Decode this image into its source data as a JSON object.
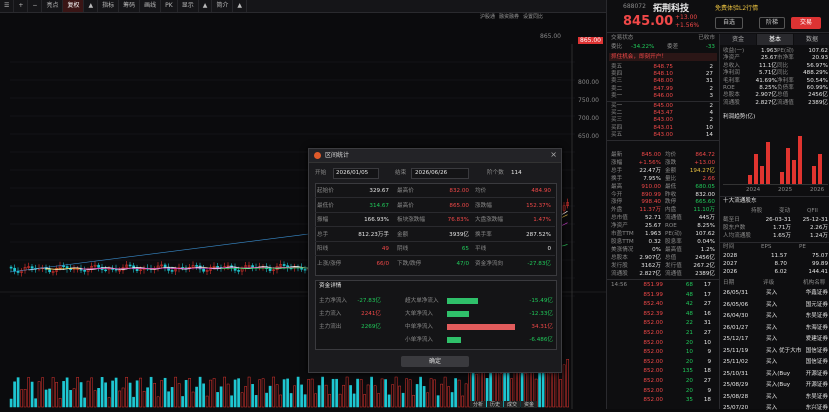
{
  "toolbar": {
    "items": [
      "☰",
      "+",
      "−",
      "亮点",
      "复权",
      "▲",
      "指标",
      "筹码",
      "画线",
      "PK",
      "显示",
      "▲",
      "简介",
      "▲"
    ],
    "sub": [
      "沪股通",
      "融资融券",
      "设置同比"
    ],
    "price_label": "865.00"
  },
  "chart": {
    "y_labels": [
      "800.00",
      "750.00",
      "700.00",
      "650.00"
    ],
    "peak_label": "865.00",
    "current_tag": "845.00",
    "bottom_tabs": [
      "分析",
      "历史",
      "成交",
      "资金"
    ]
  },
  "dialog": {
    "title": "区间统计",
    "start_label": "开始",
    "start": "2026/01/05",
    "end_label": "结束",
    "end": "2026/06/26",
    "days_label": "阶个数",
    "days": "114",
    "stats": [
      {
        "l1": "起始价",
        "v1": "329.67",
        "l2": "最高价",
        "v2": "832.00",
        "l3": "均价",
        "v3": "484.90",
        "c1": "wht",
        "c2": "red",
        "c3": "red"
      },
      {
        "l1": "最低价",
        "v1": "314.67",
        "l2": "最高价",
        "v2": "865.00",
        "l3": "涨跌幅",
        "v3": "152.37%",
        "c1": "grn",
        "c2": "red",
        "c3": "red"
      },
      {
        "l1": "振幅",
        "v1": "166.93%",
        "l2": "板块涨跌幅",
        "v2": "76.83%",
        "l3": "大盘涨跌幅",
        "v3": "1.47%",
        "c1": "wht",
        "c2": "red",
        "c3": "red"
      },
      {
        "l1": "总手",
        "v1": "812.23万手",
        "l2": "金额",
        "v2": "3939亿",
        "l3": "换手率",
        "v3": "287.52%",
        "c1": "wht",
        "c2": "wht",
        "c3": "wht"
      },
      {
        "l1": "阳线",
        "v1": "49",
        "l2": "阴线",
        "v2": "65",
        "l3": "平线",
        "v3": "0",
        "c1": "red",
        "c2": "grn",
        "c3": "wht"
      },
      {
        "l1": "上涨/涨停",
        "v1": "66/0",
        "l2": "下跌/跌停",
        "v2": "47/0",
        "l3": "资金净流向",
        "v3": "-27.83亿",
        "c1": "red",
        "c2": "grn",
        "c3": "grn"
      }
    ],
    "fund_title": "资金详情",
    "fund_left": [
      {
        "l": "主力净流入",
        "v": "-27.83亿",
        "c": "grn"
      },
      {
        "l": "主力流入",
        "v": "2241亿",
        "c": "red"
      },
      {
        "l": "主力流出",
        "v": "2269亿",
        "c": "grn"
      }
    ],
    "fund_right": [
      {
        "l": "超大单净流入",
        "v": "-15.49亿",
        "c": "grn",
        "bar": 0.45,
        "bc": "#2fc06a"
      },
      {
        "l": "大单净流入",
        "v": "-12.33亿",
        "c": "grn",
        "bar": 0.32,
        "bc": "#2fc06a"
      },
      {
        "l": "中单净流入",
        "v": "34.31亿",
        "c": "red",
        "bar": 1.0,
        "bc": "#e25c5c"
      },
      {
        "l": "小单净流入",
        "v": "-6.486亿",
        "c": "grn",
        "bar": 0.2,
        "bc": "#2fc06a"
      }
    ],
    "ok": "确定"
  },
  "rp": {
    "code": "688072",
    "name": "拓荆科技",
    "badge": "免费体验L2行情",
    "price": "845.00",
    "chg": "+13.00",
    "pct": "+1.56%",
    "btn_autoselect": "自选",
    "btn_fund": "阶梯",
    "btn_trade": "交易",
    "tag1": "交易状态",
    "tag2": "已收市",
    "wb_l": "委比",
    "wb_v": "-34.22%",
    "wc_l": "委差",
    "wc_v": "-33",
    "ad": "抓住机会，即刻开户！",
    "sells": [
      [
        "卖五",
        "848.75",
        "2"
      ],
      [
        "卖四",
        "848.10",
        "27"
      ],
      [
        "卖三",
        "848.00",
        "31"
      ],
      [
        "卖二",
        "847.99",
        "2"
      ],
      [
        "卖一",
        "846.00",
        "3"
      ]
    ],
    "buys": [
      [
        "买一",
        "845.00",
        "2"
      ],
      [
        "买二",
        "843.47",
        "4"
      ],
      [
        "买三",
        "843.00",
        "2"
      ],
      [
        "买四",
        "843.01",
        "10"
      ],
      [
        "买五",
        "843.00",
        "14"
      ]
    ],
    "quote": [
      [
        "最新",
        "845.00",
        "均价",
        "864.72",
        "red",
        "red"
      ],
      [
        "涨幅",
        "+1.56%",
        "涨跌",
        "+13.00",
        "red",
        "red"
      ],
      [
        "总手",
        "22.47万",
        "金额",
        "194.27亿",
        "wht",
        "yel"
      ],
      [
        "换手",
        "7.95%",
        "量比",
        "2.66",
        "wht",
        "red"
      ],
      [
        "最高",
        "910.00",
        "最低",
        "680.05",
        "red",
        "grn"
      ],
      [
        "今开",
        "890.99",
        "昨收",
        "832.00",
        "red",
        "wht"
      ],
      [
        "涨停",
        "998.40",
        "跌停",
        "665.60",
        "red",
        "grn"
      ],
      [
        "外盘",
        "11.37万",
        "内盘",
        "11.10万",
        "red",
        "grn"
      ],
      [
        "总市值",
        "52.71",
        "流通值",
        "445万",
        "wht",
        "wht"
      ],
      [
        "净资产",
        "25.67",
        "ROE",
        "8.25%",
        "wht",
        "wht"
      ],
      [
        "市盈TTM",
        "1.963",
        "PE(动)",
        "107.62",
        "wht",
        "wht"
      ],
      [
        "股息TTM",
        "0.32",
        "股息率",
        "0.04%",
        "wht",
        "wht"
      ],
      [
        "美涨情况",
        "0%",
        "最高值",
        "1.2%",
        "wht",
        "wht"
      ],
      [
        "总股本",
        "2.907亿",
        "总值",
        "2456亿",
        "wht",
        "wht"
      ],
      [
        "发行股",
        "3162万",
        "发行值",
        "267.2亿",
        "wht",
        "wht"
      ],
      [
        "流通股",
        "2.827亿",
        "流通值",
        "2389亿",
        "wht",
        "wht"
      ]
    ],
    "ticks": [
      [
        "14:56",
        "851.99",
        "68",
        "17"
      ],
      [
        "",
        "851.99",
        "48",
        "17"
      ],
      [
        "",
        "852.40",
        "42",
        "27"
      ],
      [
        "",
        "852.39",
        "48",
        "16"
      ],
      [
        "",
        "852.00",
        "22",
        "31"
      ],
      [
        "",
        "852.00",
        "21",
        "27"
      ],
      [
        "",
        "852.00",
        "20",
        "10"
      ],
      [
        "",
        "852.00",
        "10",
        "9"
      ],
      [
        "",
        "852.00",
        "20",
        "9"
      ],
      [
        "",
        "852.00",
        "135",
        "18"
      ],
      [
        "",
        "852.00",
        "20",
        "27"
      ],
      [
        "",
        "852.00",
        "20",
        "9"
      ],
      [
        "",
        "852.00",
        "35",
        "18"
      ]
    ],
    "tabs": [
      "资金",
      "基本",
      "数据"
    ],
    "fund_rows": [
      [
        "收益(一)",
        "1.963",
        "PE(动)",
        "107.62"
      ],
      [
        "净资产",
        "25.67",
        "市净率",
        "20.93"
      ],
      [
        "总收入",
        "11.1亿",
        "同比",
        "56.97%"
      ],
      [
        "净利润",
        "5.71亿",
        "同比",
        "488.29%"
      ],
      [
        "毛利率",
        "41.69%",
        "净利率",
        "50.54%"
      ],
      [
        "ROE",
        "8.25%",
        "负债率",
        "60.99%"
      ],
      [
        "总股本",
        "2.907亿",
        "总值",
        "2456亿"
      ],
      [
        "流通股",
        "2.827亿",
        "流通值",
        "2389亿"
      ]
    ],
    "profit_title": "利润趋势(亿)",
    "years": [
      "2024",
      "2025",
      "2026"
    ],
    "holders_title": "十大流通股东",
    "hold_head": [
      "",
      "持股",
      "变动",
      "QFII"
    ],
    "holders": [
      [
        "截至日",
        "26-03-31",
        "25-12-31"
      ],
      [
        "股东户数",
        "1.71万",
        "2.26万"
      ],
      [
        "人均流通股",
        "1.65万",
        "1.24万"
      ]
    ],
    "eps_rows": [
      [
        "2028",
        "11.57",
        "75.07"
      ],
      [
        "2027",
        "8.70",
        "99.89"
      ],
      [
        "2026",
        "6.02",
        "144.41"
      ]
    ],
    "eps_head": [
      "时间",
      "EPS",
      "PE"
    ],
    "brokers_head": [
      "日期",
      "评级",
      "机构名称"
    ],
    "brokers": [
      [
        "26/05/31",
        "买入",
        "华鑫证券"
      ],
      [
        "26/05/06",
        "买入",
        "国元证券"
      ],
      [
        "26/04/30",
        "买入",
        "东吴证券"
      ],
      [
        "26/01/27",
        "买入",
        "东海证券"
      ],
      [
        "25/12/17",
        "买入",
        "爱建证券"
      ],
      [
        "25/11/19",
        "买入 优于大市",
        "国信证券"
      ],
      [
        "25/11/02",
        "买入",
        "国信证券"
      ],
      [
        "25/10/31",
        "买入(Buy",
        "开源证券"
      ],
      [
        "25/08/29",
        "买入(Buy",
        "开源证券"
      ],
      [
        "25/08/28",
        "买入",
        "东吴证券"
      ],
      [
        "25/07/20",
        "买入",
        "东兴证券"
      ]
    ]
  }
}
